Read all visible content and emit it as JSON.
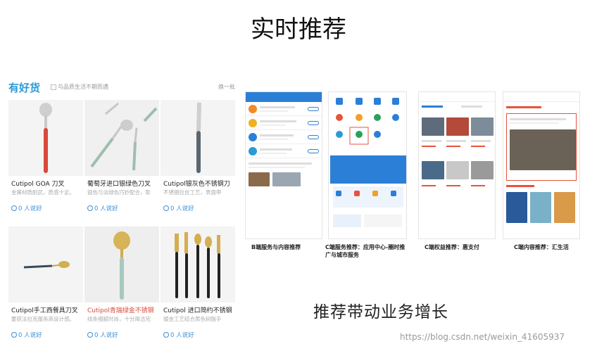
{
  "page": {
    "title": "实时推荐",
    "bottom_title": "推荐带动业务增长",
    "watermark": "https://blog.csdn.net/weixin_41605937"
  },
  "left_panel": {
    "logo": "有好货",
    "subtitle": "与品质生活不期而遇",
    "more": "换一批",
    "products": [
      {
        "name": "Cutipol GOA 刀叉",
        "desc": "金属材质耐武，质感十足。",
        "likes": "0 人说好",
        "name_color": "normal"
      },
      {
        "name": "葡萄牙进口银绿色刀叉",
        "desc": "银色与淡绿色巧妙配合，彰",
        "likes": "0 人说好",
        "name_color": "normal"
      },
      {
        "name": "Cutipol银灰色不锈钢刀",
        "desc": "不锈钢拉丝工艺，表面带",
        "likes": "0 人说好",
        "name_color": "normal"
      },
      {
        "name": "Cutipol手工西餐具刀叉",
        "desc": "要获法拉克服务高设计感。",
        "likes": "0 人说好",
        "name_color": "normal"
      },
      {
        "name": "Cutipol青瑞绿金不锈钢",
        "desc": "线条细腻时尚，十分简洁完",
        "likes": "0 人说好",
        "name_color": "red"
      },
      {
        "name": "Cutipol 进口简约不锈钢",
        "desc": "镀金工艺结合黄色树脂手",
        "likes": "0 人说好",
        "name_color": "normal"
      }
    ]
  },
  "phones": [
    {
      "caption": "B端服务与内容推荐"
    },
    {
      "caption": "C端服务推荐：应用中心-圈时推广与城市服务"
    },
    {
      "caption": "C端权益推荐：惠支付"
    },
    {
      "caption": "C端内容推荐：汇生活"
    }
  ],
  "colors": {
    "accent_blue": "#2a9bd8",
    "red": "#d9483b",
    "like_blue": "#3a8fd6"
  }
}
